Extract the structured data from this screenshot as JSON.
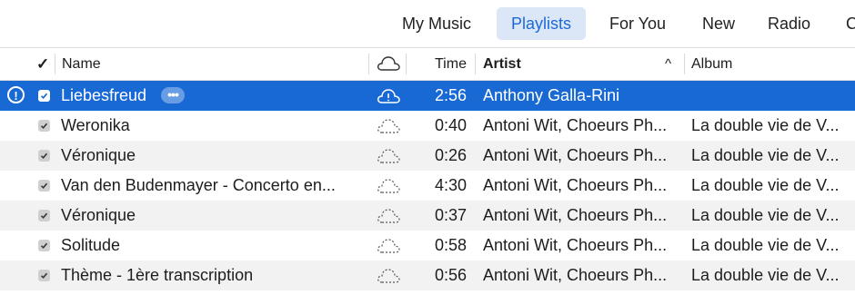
{
  "nav": {
    "tabs": [
      {
        "label": "My Music"
      },
      {
        "label": "Playlists",
        "active": true
      },
      {
        "label": "For You"
      },
      {
        "label": "New"
      },
      {
        "label": "Radio"
      },
      {
        "label": "C"
      }
    ]
  },
  "table": {
    "headers": {
      "check": "✓",
      "name": "Name",
      "cloud_icon": "cloud-icon",
      "time": "Time",
      "artist": "Artist",
      "sort_indicator": "^",
      "album": "Album"
    },
    "rows": [
      {
        "name": "Liebesfreud",
        "time": "2:56",
        "artist": "Anthony Galla-Rini",
        "album": "",
        "selected": true,
        "checked": true,
        "alert": "!",
        "more": "•••",
        "cloud": "cloud-upload-icon"
      },
      {
        "name": "Weronika",
        "time": "0:40",
        "artist": "Antoni Wit, Choeurs Ph...",
        "album": "La double vie de V...",
        "checked": true,
        "cloud": "cloud-dotted-icon"
      },
      {
        "name": "Véronique",
        "time": "0:26",
        "artist": "Antoni Wit, Choeurs Ph...",
        "album": "La double vie de V...",
        "checked": true,
        "cloud": "cloud-dotted-icon"
      },
      {
        "name": "Van den Budenmayer - Concerto en...",
        "time": "4:30",
        "artist": "Antoni Wit, Choeurs Ph...",
        "album": "La double vie de V...",
        "checked": true,
        "cloud": "cloud-dotted-icon"
      },
      {
        "name": "Véronique",
        "time": "0:37",
        "artist": "Antoni Wit, Choeurs Ph...",
        "album": "La double vie de V...",
        "checked": true,
        "cloud": "cloud-dotted-icon"
      },
      {
        "name": "Solitude",
        "time": "0:58",
        "artist": "Antoni Wit, Choeurs Ph...",
        "album": "La double vie de V...",
        "checked": true,
        "cloud": "cloud-dotted-icon"
      },
      {
        "name": "Thème - 1ère transcription",
        "time": "0:56",
        "artist": "Antoni Wit, Choeurs Ph...",
        "album": "La double vie de V...",
        "checked": true,
        "cloud": "cloud-dotted-icon"
      }
    ]
  },
  "colors": {
    "accent": "#1969d5",
    "active_tab_bg": "#dbe7f6",
    "active_tab_text": "#1c6ad9",
    "alt_row": "#f2f2f2"
  }
}
